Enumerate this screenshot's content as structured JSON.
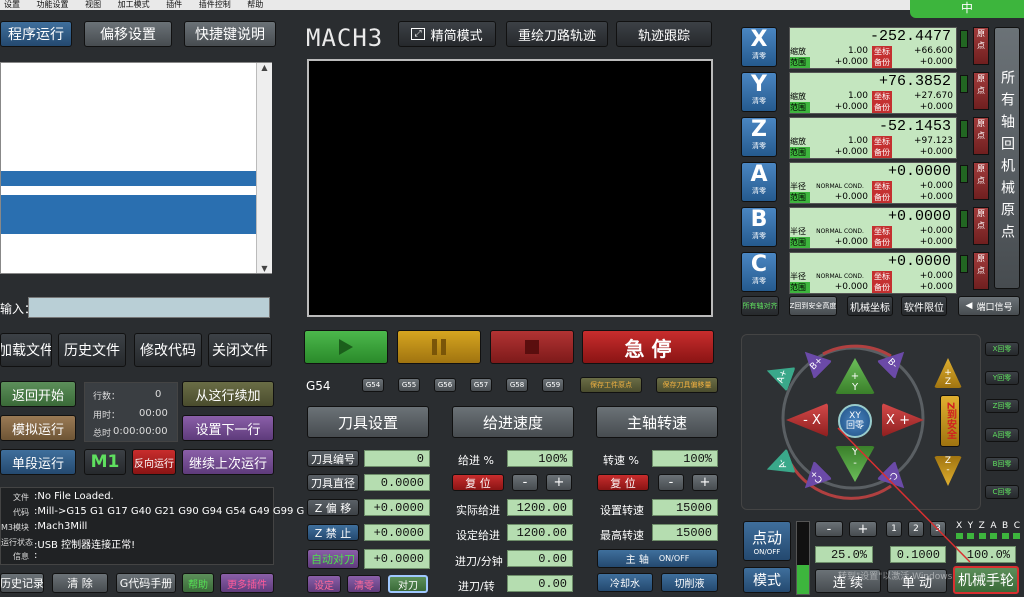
{
  "menu": {
    "items": [
      "设置",
      "功能设置",
      "视图",
      "加工模式",
      "插件",
      "插件控制",
      "帮助"
    ]
  },
  "top_tabs": [
    "程序运行",
    "偏移设置",
    "快捷键说明"
  ],
  "logo": "MACH3",
  "top_buttons": {
    "simple_mode": "精简模式",
    "redraw": "重绘刀路轨迹",
    "track": "轨迹跟踪"
  },
  "corner_tab": "中",
  "input_label": "输入：",
  "file_buttons": [
    "加载文件",
    "历史文件",
    "修改代码",
    "关闭文件"
  ],
  "run_left": {
    "rewind": "返回开始",
    "simulate": "模拟运行",
    "single": "单段运行"
  },
  "counters": {
    "line_label": "行数：",
    "line_value": "0",
    "time_label": "用时：",
    "time_value": "00:00",
    "total_label": "总时",
    "total_value": "0:00:00:00"
  },
  "run_right": {
    "from_line": "从这行续加",
    "next_line": "设置下一行",
    "continue_last": "继续上次运行",
    "m1": "M1",
    "reverse": "反向运行"
  },
  "status": {
    "file_label": "文件",
    "file_value": ":No File Loaded.",
    "code_label": "代码",
    "code_value": ":Mill->G15  G1 G17 G40 G21 G90 G94 G54 G49 G99 G",
    "module_label": "M3模块",
    "module_value": ":Mach3Mill",
    "state_label": "运行状态",
    "state_value": ":USB 控制器连接正常!",
    "info_label": "信息",
    "info_value": ":"
  },
  "bottom_left": {
    "history": "历史记录",
    "clear": "清  除",
    "gcode_manual": "G代码手册",
    "btn4": "帮助",
    "btn5": "更多插件"
  },
  "transport": {
    "estop": "急  停"
  },
  "coord_label": "G54",
  "work_offsets": [
    "G54",
    "G55",
    "G56",
    "G57",
    "G58",
    "G59"
  ],
  "offset_buttons": [
    "保存工件原点",
    "保存刀具偏移量"
  ],
  "sections": {
    "tool": "刀具设置",
    "feed": "给进速度",
    "spindle": "主轴转速"
  },
  "tool": {
    "number_label": "刀具编号",
    "number_value": "0",
    "diameter_label": "刀具直径",
    "diameter_value": "0.0000",
    "zoffset_label": "Z 偏 移",
    "zoffset_value": "+0.0000",
    "zset_label": "Z 禁 止",
    "zset_value": "+0.0000",
    "auto_label": "自动对刀",
    "auto_value": "+0.0000",
    "btn_a": "设定",
    "btn_b": "清零",
    "btn_c": "对刀"
  },
  "feed": {
    "pct_label": "给进 %",
    "pct_value": "100%",
    "reset": "复 位",
    "actual_label": "实际给进",
    "actual_value": "1200.00",
    "set_label": "设定给进",
    "set_value": "1200.00",
    "per_min_label": "进刀/分钟",
    "per_min_value": "0.00",
    "per_rev_label": "进刀/转",
    "per_rev_value": "0.00"
  },
  "spindle": {
    "pct_label": "转速 %",
    "pct_value": "100%",
    "reset": "复 位",
    "set_label": "设置转速",
    "set_value": "15000",
    "max_label": "最高转速",
    "max_value": "15000",
    "toggle_label": "主  轴",
    "toggle_state": "ON/OFF",
    "coolant": "冷却水",
    "tool_change": "切削液"
  },
  "axes": [
    {
      "name": "X",
      "zero": "清零",
      "value": "-252.4477",
      "row1_label": "缩放",
      "row1_value": "1.00",
      "row1_tag": "坐标",
      "row1_right": "+66.600",
      "row2_label": "范围",
      "row2_value": "+0.000",
      "row2_tag": "备份",
      "row2_right": "+0.000"
    },
    {
      "name": "Y",
      "zero": "清零",
      "value": "+76.3852",
      "row1_label": "缩放",
      "row1_value": "1.00",
      "row1_tag": "坐标",
      "row1_right": "+27.670",
      "row2_label": "范围",
      "row2_value": "+0.000",
      "row2_tag": "备份",
      "row2_right": "+0.000"
    },
    {
      "name": "Z",
      "zero": "清零",
      "value": "-52.1453",
      "row1_label": "缩放",
      "row1_value": "1.00",
      "row1_tag": "坐标",
      "row1_right": "+97.123",
      "row2_label": "范围",
      "row2_value": "+0.000",
      "row2_tag": "备份",
      "row2_right": "+0.000"
    },
    {
      "name": "A",
      "zero": "清零",
      "value": "+0.0000",
      "row1_label": "半径",
      "row1_value": "NORMAL COND.",
      "row1_tag": "坐标",
      "row1_right": "+0.000",
      "row2_label": "范围",
      "row2_value": "+0.000",
      "row2_tag": "备份",
      "row2_right": "+0.000"
    },
    {
      "name": "B",
      "zero": "清零",
      "value": "+0.0000",
      "row1_label": "半径",
      "row1_value": "NORMAL COND.",
      "row1_tag": "坐标",
      "row1_right": "+0.000",
      "row2_label": "范围",
      "row2_value": "+0.000",
      "row2_tag": "备份",
      "row2_right": "+0.000"
    },
    {
      "name": "C",
      "zero": "清零",
      "value": "+0.0000",
      "row1_label": "半径",
      "row1_value": "NORMAL COND.",
      "row1_tag": "坐标",
      "row1_right": "+0.000",
      "row2_label": "范围",
      "row2_value": "+0.000",
      "row2_tag": "备份",
      "row2_right": "+0.000"
    }
  ],
  "axis_side": [
    "原点",
    "原点",
    "原点",
    "原点",
    "原点",
    "原点"
  ],
  "home_all": "所有轴回机械原点",
  "dro_buttons": {
    "soft_limits": "软件限位",
    "machine_coords": "机械坐标",
    "z_safe": "Z回到安全高度",
    "goto_zero": "所有轴对齐",
    "port": "端口信号"
  },
  "jog": {
    "xminus": "- X",
    "xplus": "X +",
    "yplus": "+\nY",
    "yminus": "Y\n-",
    "center": "XY\n回零",
    "bplus": "B+",
    "bminus": "B-",
    "aplus": "A+",
    "aminus": "A-",
    "cplus": "C+",
    "cminus": "C-",
    "zplus": "+\nZ",
    "zminus": "Z\n-",
    "zsafe": "Z到安全",
    "jog_label": "点动",
    "jog_mode": "ON/OFF",
    "mode_label": "模式",
    "continuous": "连 续",
    "step": "单 动",
    "handwheel": "机械手轮",
    "rate1": "25.0%",
    "rate2": "0.1000",
    "rate3": "100.0%",
    "steps": [
      "1",
      "2",
      "3"
    ],
    "axes": [
      "X",
      "Y",
      "Z",
      "A",
      "B",
      "C"
    ]
  },
  "right_side": [
    "X回零",
    "Y回零",
    "Z回零",
    "A回零",
    "B回零",
    "C回零"
  ],
  "watermark": "转到\"设置\"以激活 Windows",
  "colors": {
    "accent": "#2a6fb0",
    "estop": "#c82d2d",
    "dro_bg": "#c4e6bf",
    "highlight": "#d83030"
  }
}
